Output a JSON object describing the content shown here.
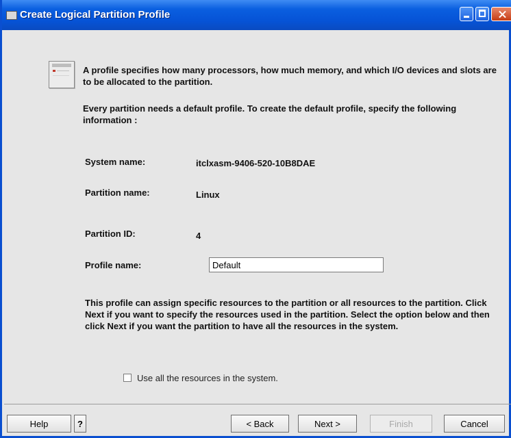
{
  "window": {
    "title": "Create Logical Partition Profile"
  },
  "intro": {
    "line1": "A profile specifies how many processors, how much memory, and which I/O devices and slots are to be allocated to the partition.",
    "line2": "Every partition needs a default profile.  To create the default profile, specify the following information :"
  },
  "fields": {
    "system_name_label": "System name:",
    "system_name_value": "itclxasm-9406-520-10B8DAE",
    "partition_name_label": "Partition name:",
    "partition_name_value": "Linux",
    "partition_id_label": "Partition ID:",
    "partition_id_value": "4",
    "profile_name_label": "Profile name:",
    "profile_name_value": "Default"
  },
  "description": "This profile can assign specific resources to the partition or all resources to the partition.  Click Next if you want to specify the resources used in the partition.  Select the option below and then click Next if you want the partition to have all the resources in the system.",
  "checkbox": {
    "label": "Use all the resources in the system.",
    "checked": false
  },
  "buttons": {
    "help": "Help",
    "question": "?",
    "back": "< Back",
    "next": "Next >",
    "finish": "Finish",
    "cancel": "Cancel"
  }
}
